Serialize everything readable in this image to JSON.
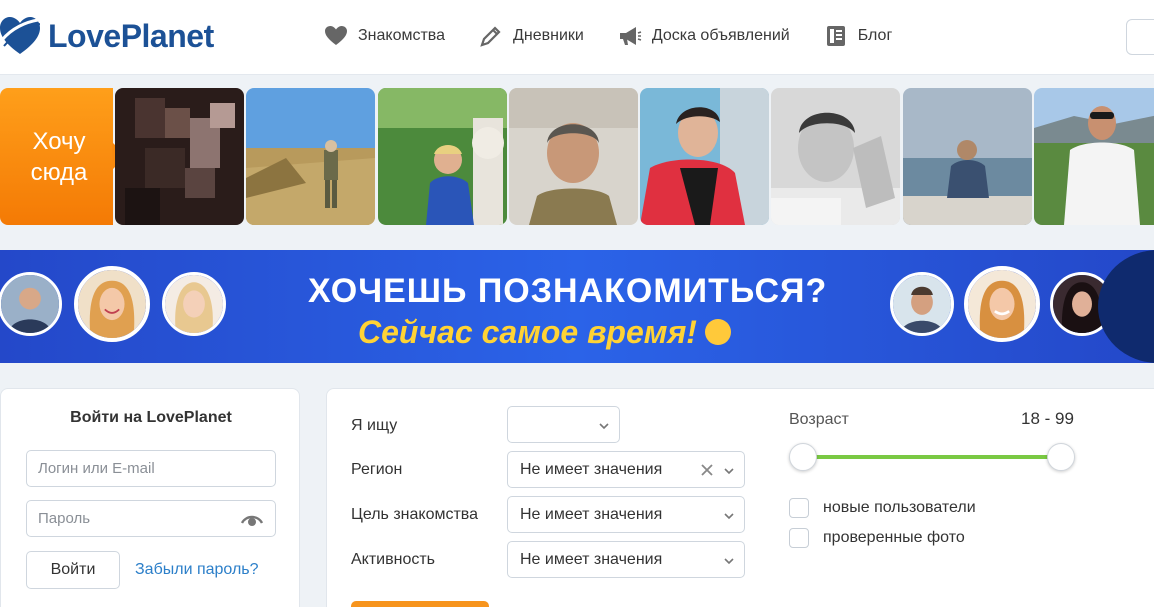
{
  "header": {
    "logo_text": "LovePlanet",
    "nav": [
      {
        "label": "Знакомства",
        "icon": "heart-icon"
      },
      {
        "label": "Дневники",
        "icon": "pencil-icon"
      },
      {
        "label": "Доска объявлений",
        "icon": "megaphone-icon"
      },
      {
        "label": "Блог",
        "icon": "blog-icon"
      }
    ]
  },
  "strip": {
    "promo_line1": "Хочу",
    "promo_line2": "сюда"
  },
  "banner": {
    "title": "ХОЧЕШЬ ПОЗНАКОМИТЬСЯ?",
    "subtitle": "Сейчас самое время!"
  },
  "login": {
    "title": "Войти на LovePlanet",
    "login_placeholder": "Логин или E-mail",
    "password_placeholder": "Пароль",
    "submit_label": "Войти",
    "forgot_label": "Забыли пароль?"
  },
  "search": {
    "looking_for_label": "Я ищу",
    "looking_for_value": "",
    "region_label": "Регион",
    "region_value": "Не имеет значения",
    "goal_label": "Цель знакомства",
    "goal_value": "Не имеет значения",
    "activity_label": "Активность",
    "activity_value": "Не имеет значения",
    "age_label": "Возраст",
    "age_range": "18 - 99",
    "age_min": 18,
    "age_max": 99,
    "new_users_label": "новые пользователи",
    "verified_photo_label": "проверенные фото"
  },
  "colors": {
    "brand": "#1c5196",
    "accent_orange": "#f7941d",
    "slider_green": "#7ac943",
    "link_blue": "#2c7fc9",
    "banner_blue": "#2b63e8",
    "banner_yellow": "#ffd335"
  }
}
